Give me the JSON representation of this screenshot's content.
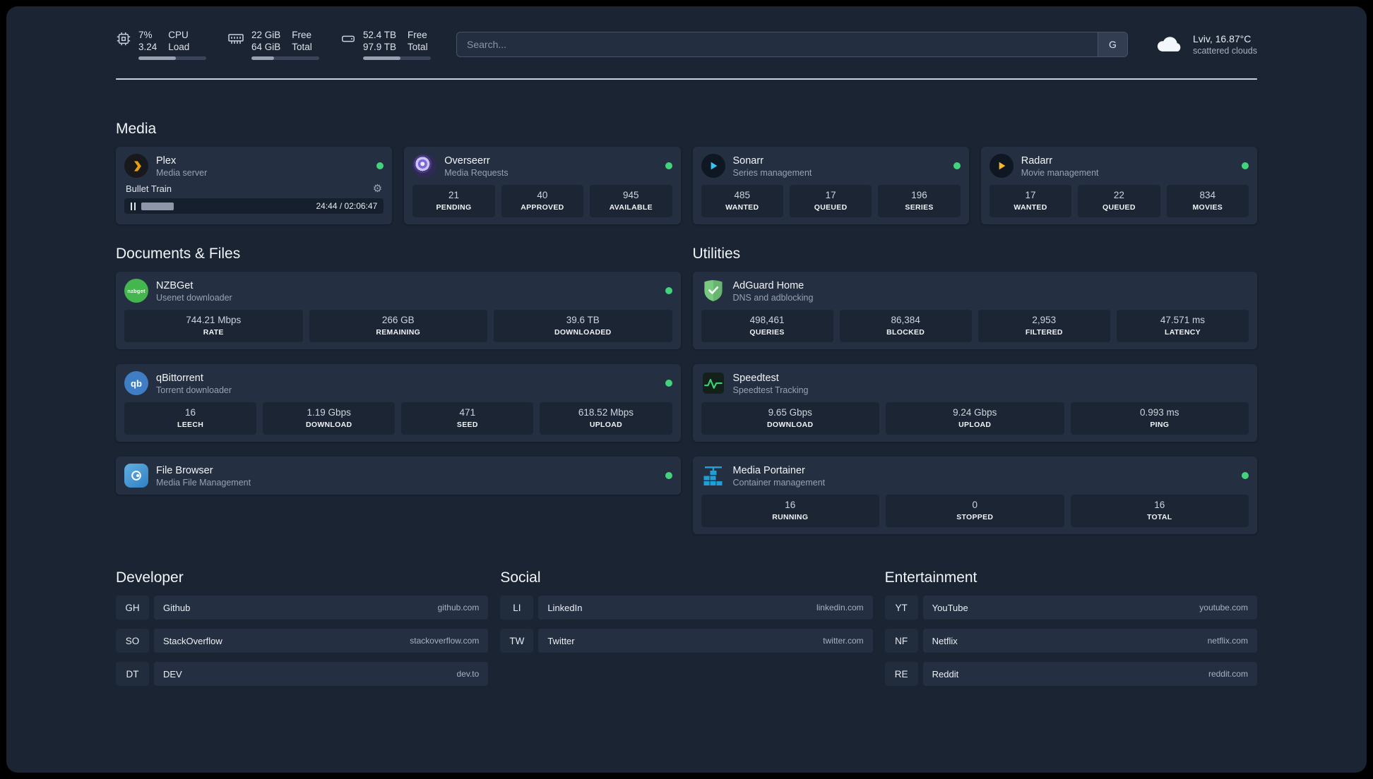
{
  "colors": {
    "status_online": "#42d37c",
    "page_background": "#1b2433",
    "card_background": "#242f41",
    "accent_plex": "#e5a00d",
    "accent_sonarr": "#35c5f4",
    "accent_radarr": "#f7b731",
    "accent_adguard": "#67b56f",
    "accent_portainer": "#1f9fd8"
  },
  "icons": {
    "gear": "⚙",
    "nzbget_label": "nzbget",
    "qb_label": "qb"
  },
  "topbar": {
    "cpu": {
      "value1": "7%",
      "label1": "CPU",
      "value2": "3.24",
      "label2": "Load",
      "bar": 55
    },
    "memory": {
      "value1": "22 GiB",
      "label1": "Free",
      "value2": "64 GiB",
      "label2": "Total",
      "bar": 33
    },
    "disk": {
      "value1": "52.4 TB",
      "label1": "Free",
      "value2": "97.9 TB",
      "label2": "Total",
      "bar": 55
    },
    "search": {
      "placeholder": "Search...",
      "button_label": "G"
    },
    "weather": {
      "location": "Lviv, 16.87°C",
      "condition": "scattered clouds"
    }
  },
  "sections": {
    "media": {
      "title": "Media",
      "plex": {
        "name": "Plex",
        "subtitle": "Media server",
        "now_playing": "Bullet Train",
        "time": "24:44 / 02:06:47",
        "progress_percent": 19
      },
      "overseerr": {
        "name": "Overseerr",
        "subtitle": "Media Requests",
        "stats": [
          {
            "value": "21",
            "label": "PENDING"
          },
          {
            "value": "40",
            "label": "APPROVED"
          },
          {
            "value": "945",
            "label": "AVAILABLE"
          }
        ]
      },
      "sonarr": {
        "name": "Sonarr",
        "subtitle": "Series management",
        "stats": [
          {
            "value": "485",
            "label": "WANTED"
          },
          {
            "value": "17",
            "label": "QUEUED"
          },
          {
            "value": "196",
            "label": "SERIES"
          }
        ]
      },
      "radarr": {
        "name": "Radarr",
        "subtitle": "Movie management",
        "stats": [
          {
            "value": "17",
            "label": "WANTED"
          },
          {
            "value": "22",
            "label": "QUEUED"
          },
          {
            "value": "834",
            "label": "MOVIES"
          }
        ]
      }
    },
    "documents": {
      "title": "Documents & Files",
      "nzbget": {
        "name": "NZBGet",
        "subtitle": "Usenet downloader",
        "stats": [
          {
            "value": "744.21 Mbps",
            "label": "RATE"
          },
          {
            "value": "266 GB",
            "label": "REMAINING"
          },
          {
            "value": "39.6 TB",
            "label": "DOWNLOADED"
          }
        ]
      },
      "qbittorrent": {
        "name": "qBittorrent",
        "subtitle": "Torrent downloader",
        "stats": [
          {
            "value": "16",
            "label": "LEECH"
          },
          {
            "value": "1.19 Gbps",
            "label": "DOWNLOAD"
          },
          {
            "value": "471",
            "label": "SEED"
          },
          {
            "value": "618.52 Mbps",
            "label": "UPLOAD"
          }
        ]
      },
      "filebrowser": {
        "name": "File Browser",
        "subtitle": "Media File Management"
      }
    },
    "utilities": {
      "title": "Utilities",
      "adguard": {
        "name": "AdGuard Home",
        "subtitle": "DNS and adblocking",
        "stats": [
          {
            "value": "498,461",
            "label": "QUERIES"
          },
          {
            "value": "86,384",
            "label": "BLOCKED"
          },
          {
            "value": "2,953",
            "label": "FILTERED"
          },
          {
            "value": "47.571 ms",
            "label": "LATENCY"
          }
        ]
      },
      "speedtest": {
        "name": "Speedtest",
        "subtitle": "Speedtest Tracking",
        "stats": [
          {
            "value": "9.65 Gbps",
            "label": "DOWNLOAD"
          },
          {
            "value": "9.24 Gbps",
            "label": "UPLOAD"
          },
          {
            "value": "0.993 ms",
            "label": "PING"
          }
        ]
      },
      "portainer": {
        "name": "Media Portainer",
        "subtitle": "Container management",
        "stats": [
          {
            "value": "16",
            "label": "RUNNING"
          },
          {
            "value": "0",
            "label": "STOPPED"
          },
          {
            "value": "16",
            "label": "TOTAL"
          }
        ]
      }
    }
  },
  "bookmarks": {
    "developer": {
      "title": "Developer",
      "items": [
        {
          "abbr": "GH",
          "name": "Github",
          "url": "github.com"
        },
        {
          "abbr": "SO",
          "name": "StackOverflow",
          "url": "stackoverflow.com"
        },
        {
          "abbr": "DT",
          "name": "DEV",
          "url": "dev.to"
        }
      ]
    },
    "social": {
      "title": "Social",
      "items": [
        {
          "abbr": "LI",
          "name": "LinkedIn",
          "url": "linkedin.com"
        },
        {
          "abbr": "TW",
          "name": "Twitter",
          "url": "twitter.com"
        }
      ]
    },
    "entertainment": {
      "title": "Entertainment",
      "items": [
        {
          "abbr": "YT",
          "name": "YouTube",
          "url": "youtube.com"
        },
        {
          "abbr": "NF",
          "name": "Netflix",
          "url": "netflix.com"
        },
        {
          "abbr": "RE",
          "name": "Reddit",
          "url": "reddit.com"
        }
      ]
    }
  }
}
